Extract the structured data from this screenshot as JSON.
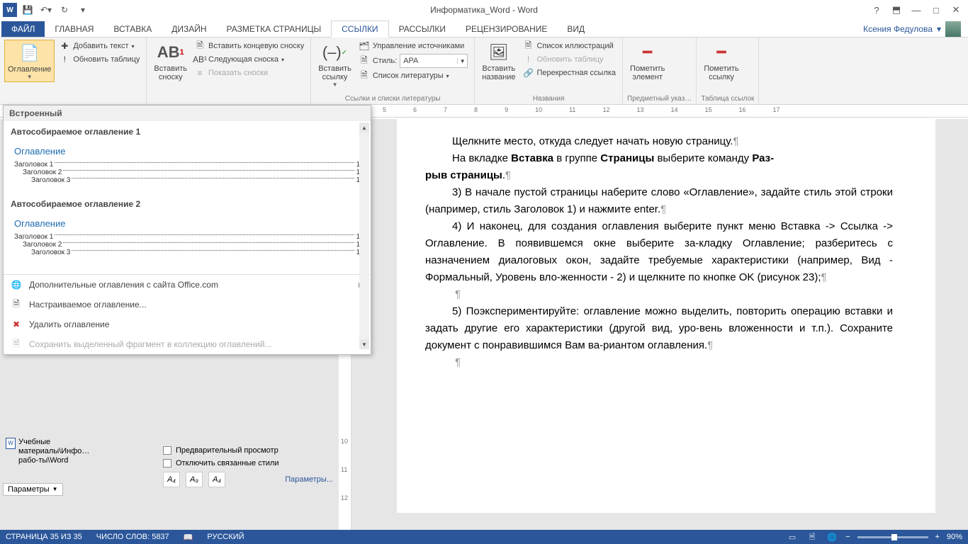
{
  "titlebar": {
    "document_title": "Информатика_Word - Word"
  },
  "tabs": {
    "file": "ФАЙЛ",
    "home": "ГЛАВНАЯ",
    "insert": "ВСТАВКА",
    "design": "ДИЗАЙН",
    "layout": "РАЗМЕТКА СТРАНИЦЫ",
    "references": "ССЫЛКИ",
    "mailings": "РАССЫЛКИ",
    "review": "РЕЦЕНЗИРОВАНИЕ",
    "view": "ВИД"
  },
  "user": {
    "name": "Ксения Федулова"
  },
  "ribbon": {
    "toc": {
      "button": "Оглавление",
      "add_text": "Добавить текст",
      "update_table": "Обновить таблицу",
      "group_label": ""
    },
    "footnotes": {
      "insert_footnote": "Вставить\nсноску",
      "ab_mark": "AB",
      "insert_endnote": "Вставить концевую сноску",
      "next_footnote": "Следующая сноска",
      "show_notes": "Показать сноски",
      "group_label": ""
    },
    "citations": {
      "insert_citation": "Вставить\nссылку",
      "manage_sources": "Управление источниками",
      "style_label": "Стиль:",
      "style_value": "APA",
      "bibliography": "Список литературы",
      "group_label": "Ссылки и списки литературы"
    },
    "captions": {
      "insert_caption": "Вставить\nназвание",
      "insert_tof": "Список иллюстраций",
      "update_table": "Обновить таблицу",
      "cross_reference": "Перекрестная ссылка",
      "group_label": "Названия"
    },
    "index": {
      "mark_entry": "Пометить\nэлемент",
      "group_label": "Предметный указ…"
    },
    "authorities": {
      "mark_citation": "Пометить\nссылку",
      "group_label": "Таблица ссылок"
    }
  },
  "dropdown": {
    "builtin_header": "Встроенный",
    "item1_title": "Автособираемое оглавление 1",
    "item2_title": "Автособираемое оглавление 2",
    "preview_heading": "Оглавление",
    "h1": "Заголовок 1",
    "h2": "Заголовок 2",
    "h3": "Заголовок 3",
    "page_num": "1",
    "more_office": "Дополнительные оглавления с сайта Office.com",
    "custom_toc": "Настраиваемое оглавление...",
    "remove_toc": "Удалить оглавление",
    "save_selection": "Сохранить выделенный фрагмент в коллекцию оглавлений..."
  },
  "nav": {
    "doc_path_1": "Учебные",
    "doc_path_2": "материалы\\Инфо…",
    "doc_path_3": "рабо-ты\\Word",
    "params": "Параметры"
  },
  "stylepane": {
    "preview_checkbox": "Предварительный просмотр",
    "disable_linked": "Отключить связанные стили",
    "a1": "A₄",
    "a2": "A₉",
    "a3": "A₄",
    "params": "Параметры..."
  },
  "document": {
    "p1": "Щелкните место, откуда следует начать новую страницу.",
    "p2a": "На вкладке ",
    "p2b": "Вставка",
    "p2c": " в группе ",
    "p2d": "Страницы",
    "p2e": " выберите команду ",
    "p2f": "Раз-",
    "p3a": "рыв страницы",
    "p3b": ".",
    "p4": "3) В начале пустой страницы наберите слово «Оглавление», задайте стиль этой строки (например, стиль Заголовок 1) и нажмите enter.",
    "p5": "4) И наконец, для создания оглавления выберите пункт меню Вставка -> Ссылка -> Оглавление. В появившемся окне выберите за-кладку Оглавление; разберитесь с назначением диалоговых окон, задайте требуемые характеристики (например, Вид - Формальный, Уровень вло-женности - 2) и щелкните по кнопке OK (рисунок 23);",
    "p6": "5) Поэкспериментируйте: оглавление можно выделить, повторить операцию вставки и задать другие его характеристики (другой вид, уро-вень вложенности и т.п.). Сохраните документ с понравившимся Вам ва-риантом оглавления."
  },
  "ruler": {
    "marks": [
      "5",
      "6",
      "7",
      "8",
      "9",
      "10",
      "11",
      "12",
      "13",
      "14",
      "15",
      "16",
      "17"
    ]
  },
  "vruler": {
    "m1": "10",
    "m2": "11",
    "m3": "12"
  },
  "status": {
    "page": "СТРАНИЦА 35 ИЗ 35",
    "words": "ЧИСЛО СЛОВ: 5837",
    "lang": "РУССКИЙ",
    "zoom": "90%"
  }
}
